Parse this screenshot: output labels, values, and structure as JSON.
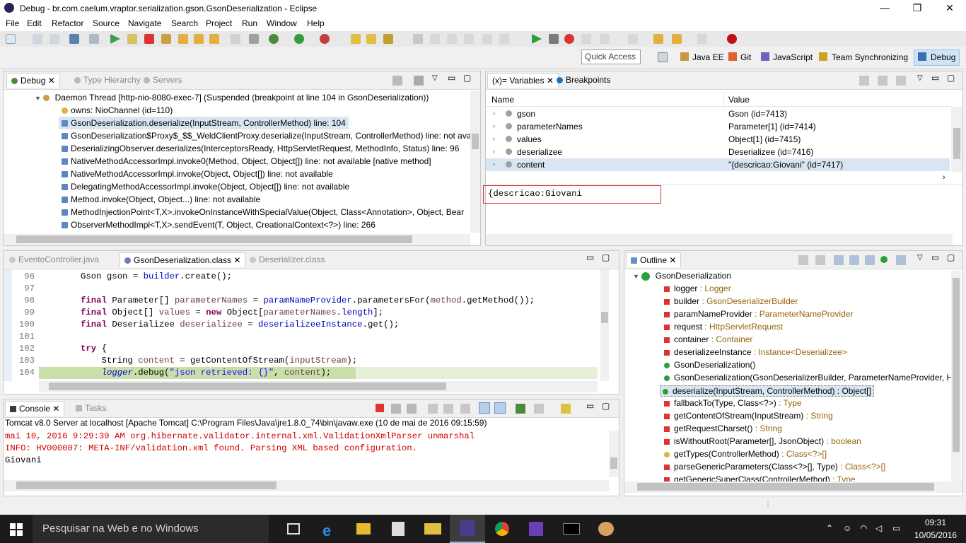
{
  "window": {
    "title": "Debug - br.com.caelum.vraptor.serialization.gson.GsonDeserialization - Eclipse",
    "minimize": "—",
    "maximize": "❐",
    "close": "✕"
  },
  "menu": [
    "File",
    "Edit",
    "Refactor",
    "Source",
    "Navigate",
    "Search",
    "Project",
    "Run",
    "Window",
    "Help"
  ],
  "quick_access": {
    "placeholder": "Quick Access"
  },
  "perspectives": [
    "Java EE",
    "Git",
    "JavaScript",
    "Team Synchronizing",
    "Debug"
  ],
  "debug_view": {
    "tabs": [
      "Debug",
      "Type Hierarchy",
      "Servers"
    ],
    "thread": "Daemon Thread [http-nio-8080-exec-7] (Suspended (breakpoint at line 104 in GsonDeserialization))",
    "owns": "owns: NioChannel  (id=110)",
    "frames": [
      "GsonDeserialization.deserialize(InputStream, ControllerMethod) line: 104",
      "GsonDeserialization$Proxy$_$$_WeldClientProxy.deserialize(InputStream, ControllerMethod) line: not avai",
      "DeserializingObserver.deserializes(InterceptorsReady, HttpServletRequest, MethodInfo, Status) line: 96",
      "NativeMethodAccessorImpl.invoke0(Method, Object, Object[]) line: not available [native method]",
      "NativeMethodAccessorImpl.invoke(Object, Object[]) line: not available",
      "DelegatingMethodAccessorImpl.invoke(Object, Object[]) line: not available",
      "Method.invoke(Object, Object...) line: not available",
      "MethodInjectionPoint<T,X>.invokeOnInstanceWithSpecialValue(Object, Class<Annotation>, Object, Bear",
      "ObserverMethodImpl<T,X>.sendEvent(T, Object, CreationalContext<?>) line: 266"
    ]
  },
  "variables_view": {
    "tabs": [
      "(x)= Variables",
      "Breakpoints"
    ],
    "headers": [
      "Name",
      "Value"
    ],
    "rows": [
      {
        "name": "gson",
        "value": "Gson  (id=7413)"
      },
      {
        "name": "parameterNames",
        "value": "Parameter[1]  (id=7414)"
      },
      {
        "name": "values",
        "value": "Object[1]  (id=7415)"
      },
      {
        "name": "deserializee",
        "value": "Deserializee  (id=7416)"
      },
      {
        "name": "content",
        "value": "\"{descricao:Giovani\" (id=7417)"
      }
    ],
    "detail": "{descricao:Giovani"
  },
  "editor": {
    "tabs": [
      "EventoController.java",
      "GsonDeserialization.class",
      "Deserializer.class"
    ],
    "line_numbers": [
      "96",
      "97",
      "98",
      "99",
      "100",
      "101",
      "102",
      "103",
      "104"
    ]
  },
  "outline_view": {
    "tab": "Outline",
    "root": "GsonDeserialization",
    "items": [
      {
        "name": "logger",
        "type": " : Logger",
        "marker": "SF"
      },
      {
        "name": "builder",
        "type": " : GsonDeserializerBuilder",
        "marker": "F"
      },
      {
        "name": "paramNameProvider",
        "type": " : ParameterNameProvider",
        "marker": "F"
      },
      {
        "name": "request",
        "type": " : HttpServletRequest",
        "marker": "F"
      },
      {
        "name": "container",
        "type": " : Container",
        "marker": "F"
      },
      {
        "name": "deserializeeInstance",
        "type": " : Instance<Deserializee>",
        "marker": "F"
      },
      {
        "name": "GsonDeserialization()",
        "type": "",
        "marker": "C"
      },
      {
        "name": "GsonDeserialization(GsonDeserializerBuilder, ParameterNameProvider, H",
        "type": "",
        "marker": "C"
      },
      {
        "name": "deserialize(InputStream, ControllerMethod) : Object[]",
        "type": "",
        "marker": "pub"
      },
      {
        "name": "fallbackTo(Type, Class<?>)",
        "type": " : Type",
        "marker": "priv"
      },
      {
        "name": "getContentOfStream(InputStream)",
        "type": " : String",
        "marker": "priv"
      },
      {
        "name": "getRequestCharset()",
        "type": " : String",
        "marker": "priv"
      },
      {
        "name": "isWithoutRoot(Parameter[], JsonObject)",
        "type": " : boolean",
        "marker": "priv"
      },
      {
        "name": "getTypes(ControllerMethod)",
        "type": " : Class<?>[]",
        "marker": "prot"
      },
      {
        "name": "parseGenericParameters(Class<?>[], Type)",
        "type": " : Class<?>[]",
        "marker": "priv"
      },
      {
        "name": "getGenericSuperClass(ControllerMethod)",
        "type": " : Type",
        "marker": "priv"
      }
    ]
  },
  "console_view": {
    "tabs": [
      "Console",
      "Tasks"
    ],
    "header": "Tomcat v8.0 Server at localhost [Apache Tomcat] C:\\Program Files\\Java\\jre1.8.0_74\\bin\\javaw.exe (10 de mai de 2016 09:15:59)",
    "lines": [
      {
        "text": "mai 10, 2016 9:29:39 AM org.hibernate.validator.internal.xml.ValidationXmlParser unmarshal",
        "color": "#d00000"
      },
      {
        "text": "INFO: HV000007: META-INF/validation.xml found. Parsing XML based configuration.",
        "color": "#d00000"
      },
      {
        "text": "Giovani",
        "color": "#000000"
      }
    ]
  },
  "taskbar": {
    "search": "Pesquisar na Web e no Windows",
    "time": "09:31",
    "date": "10/05/2016"
  }
}
